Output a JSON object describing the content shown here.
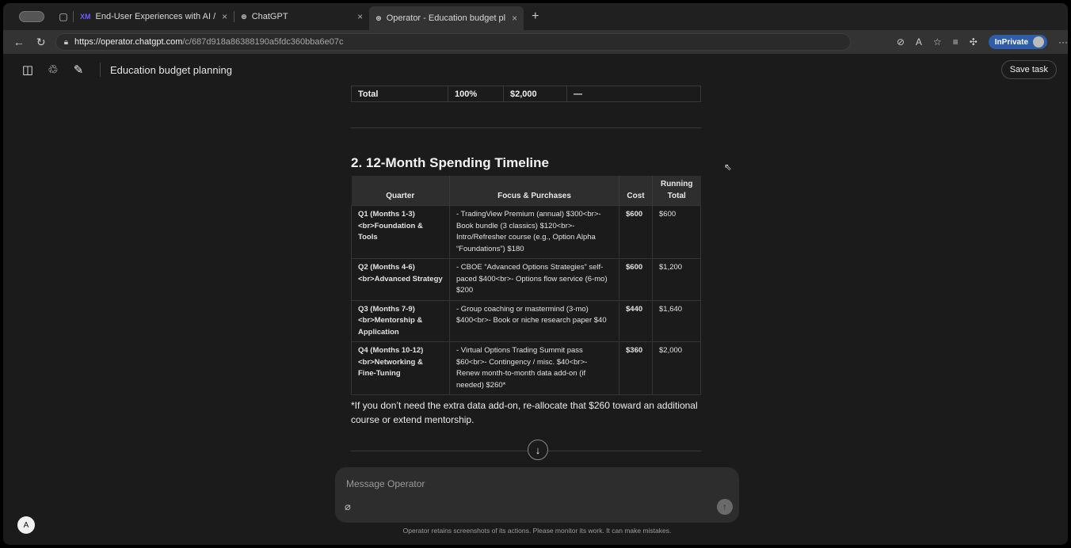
{
  "browser": {
    "tabs": [
      {
        "favicon": "XM",
        "title": "End-User Experiences with AI /",
        "close": "×"
      },
      {
        "favicon": "⊛",
        "title": "ChatGPT",
        "close": "×"
      },
      {
        "favicon": "⊛",
        "title": "Operator - Education budget pl",
        "close": "×"
      }
    ],
    "new_tab": "+",
    "url_host": "https://operator.chatgpt.com",
    "url_path": "/c/687d918a86388190a5fdc360bba6e07c",
    "inprivate": "InPrivate",
    "more": "···"
  },
  "header": {
    "title": "Education budget planning",
    "save_label": "Save task"
  },
  "total_row": {
    "label": "Total",
    "pct": "100%",
    "amount": "$2,000",
    "note": "—"
  },
  "section_title": "2. 12-Month Spending Timeline",
  "timeline": {
    "headers": {
      "quarter": "Quarter",
      "focus": "Focus & Purchases",
      "cost": "Cost",
      "running": "Running Total"
    },
    "rows": [
      {
        "quarter": "Q1 (Months 1-3)<br>Foundation & Tools",
        "focus": "- TradingView Premium (annual) $300<br>- Book bundle (3 classics) $120<br>- Intro/Refresher course (e.g., Option Alpha “Foundations”) $180",
        "cost": "$600",
        "running": "$600"
      },
      {
        "quarter": "Q2 (Months 4-6)<br>Advanced Strategy",
        "focus": "- CBOE “Advanced Options Strategies” self-paced $400<br>- Options flow service (6-mo) $200",
        "cost": "$600",
        "running": "$1,200"
      },
      {
        "quarter": "Q3 (Months 7-9)<br>Mentorship & Application",
        "focus": "- Group coaching or mastermind (3-mo) $400<br>- Book or niche research paper $40",
        "cost": "$440",
        "running": "$1,640"
      },
      {
        "quarter": "Q4 (Months 10-12)<br>Networking & Fine-Tuning",
        "focus": "- Virtual Options Trading Summit pass $60<br>- Contingency / misc. $40<br>- Renew month-to-month data add-on (if needed) $260*",
        "cost": "$360",
        "running": "$2,000"
      }
    ]
  },
  "footnote": "*If you don’t need the extra data add-on, re-allocate that $260 toward an additional course or extend mentorship.",
  "composer": {
    "placeholder": "Message Operator"
  },
  "footer_text": "Operator retains screenshots of its actions. Please monitor its work. It can make mistakes.",
  "user_avatar": "A",
  "icons": [
    "sidebar-icon",
    "new-chat-icon",
    "edit-icon",
    "arrow-down-icon",
    "paperclip-icon",
    "arrow-up-icon"
  ]
}
